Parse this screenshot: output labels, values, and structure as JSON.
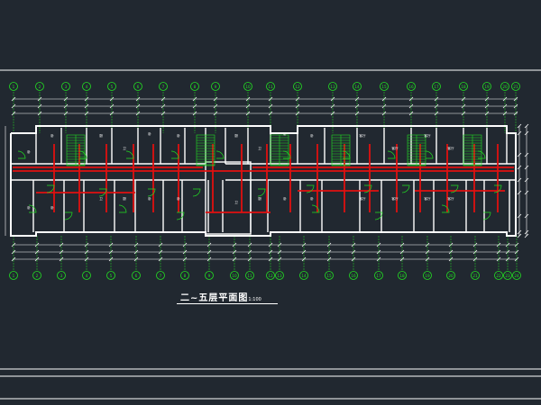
{
  "drawing": {
    "title": "二~五层平面图",
    "scale": "1:100",
    "colors": {
      "background": "#212830",
      "wall": "#ffffff",
      "partition": "#e01010",
      "door": "#22e022",
      "frame": "#ffffff",
      "dim": "#ffffff",
      "axis_bubble": "#22e022",
      "room_text": "#ffffff"
    },
    "grid_top_labels": [
      "1",
      "2",
      "3",
      "4",
      "5",
      "6",
      "7",
      "8",
      "9",
      "10",
      "11",
      "12",
      "13",
      "14",
      "15",
      "16",
      "17",
      "18",
      "19",
      "20",
      "21"
    ],
    "grid_bottom_labels": [
      "1",
      "2",
      "3",
      "4",
      "5",
      "6",
      "7",
      "8",
      "9",
      "10",
      "11",
      "12",
      "13",
      "14",
      "15",
      "16",
      "17",
      "18",
      "19",
      "20",
      "21",
      "22",
      "23",
      "24"
    ],
    "room_labels": [
      "卧",
      "卧",
      "厨",
      "卫",
      "卧",
      "卧",
      "厨",
      "卫",
      "卧",
      "卧",
      "客厅",
      "客厅",
      "客厅",
      "客厅",
      "卧",
      "卧",
      "卫",
      "厨",
      "卧",
      "卧",
      "卫",
      "厨",
      "卧",
      "卧",
      "客厅",
      "客厅",
      "客厅",
      "客厅"
    ]
  }
}
